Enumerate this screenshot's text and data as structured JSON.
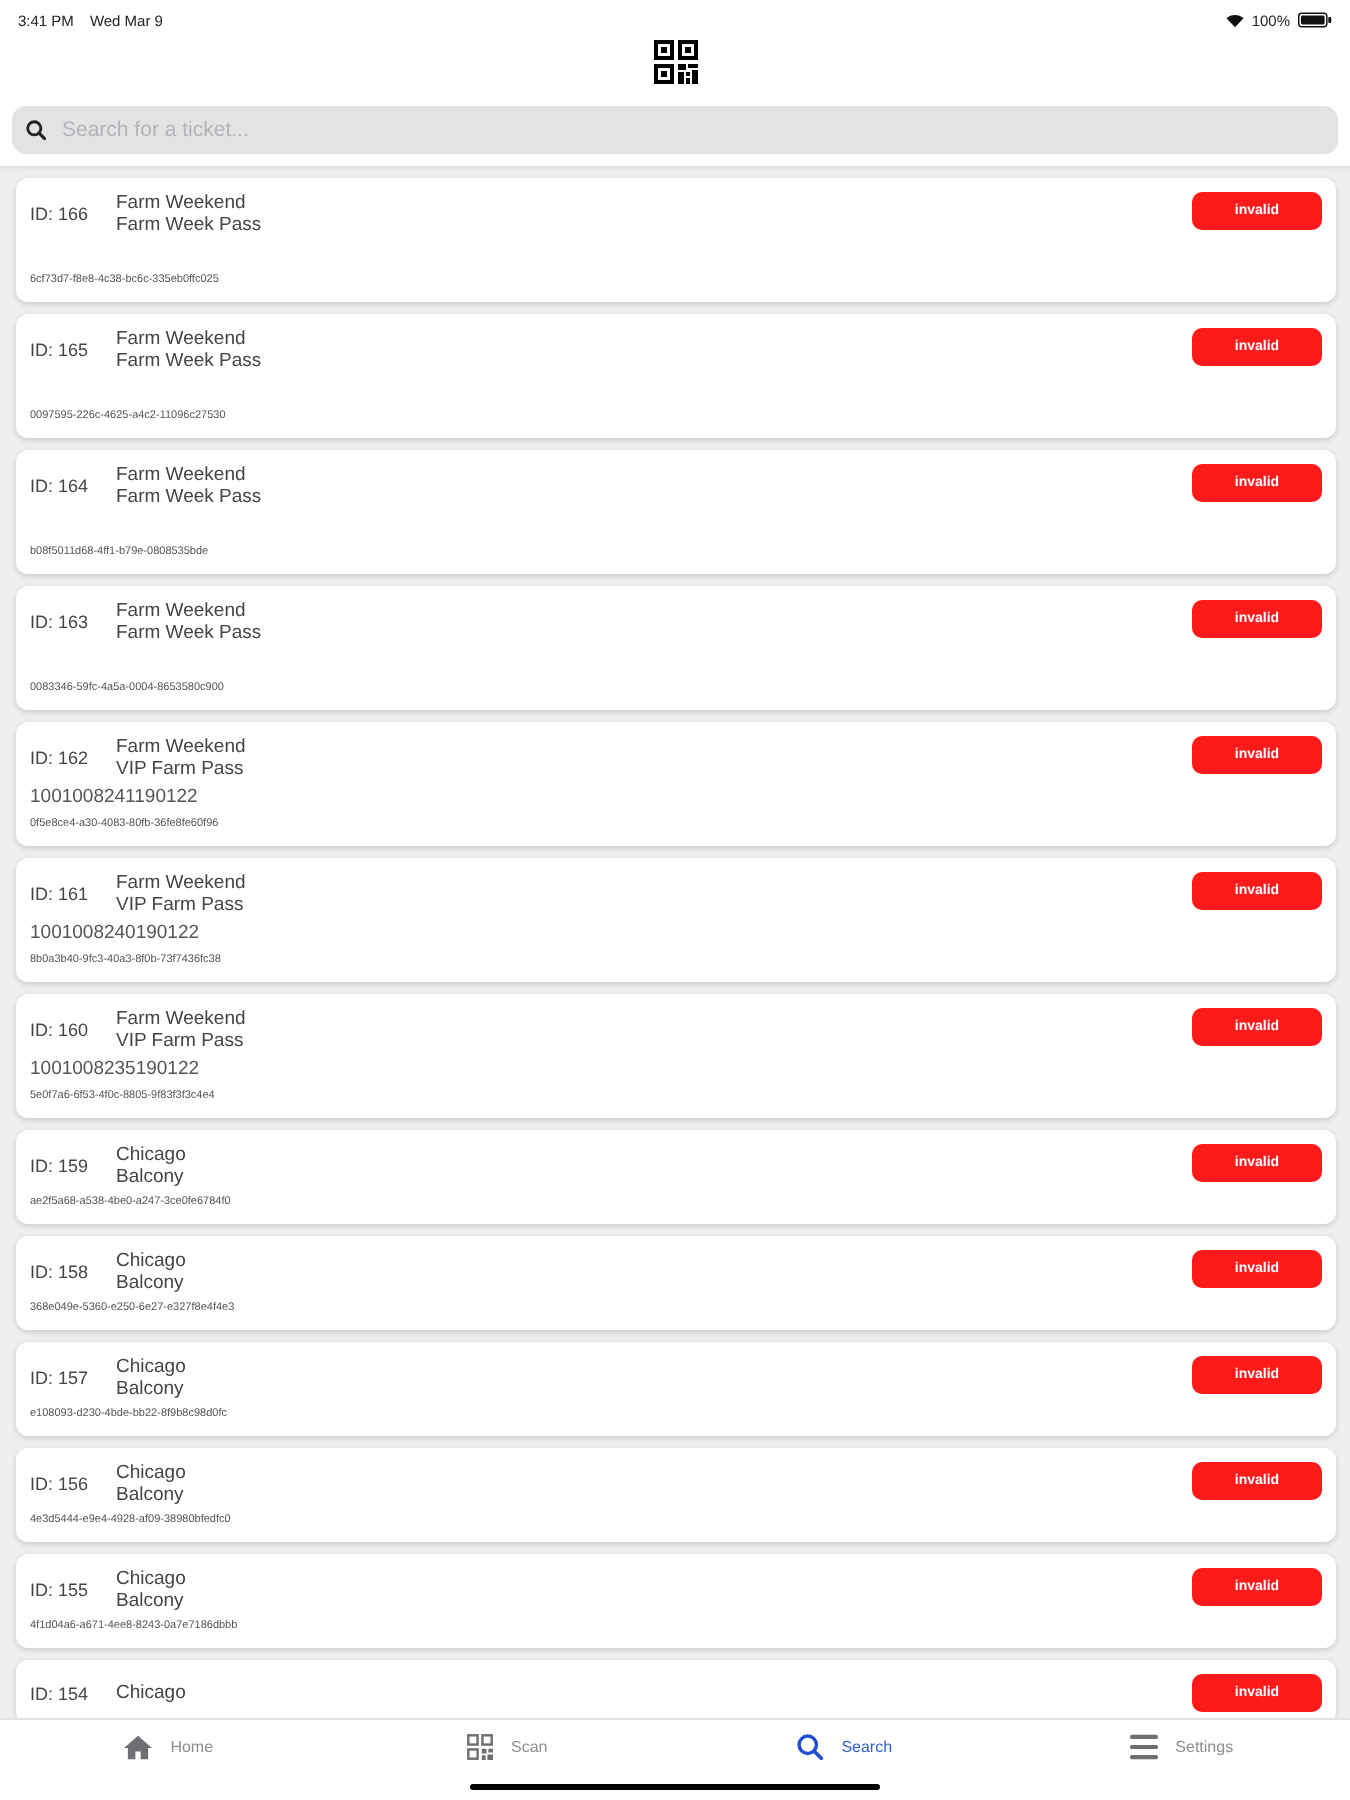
{
  "status_bar": {
    "time": "3:41 PM",
    "date": "Wed Mar 9",
    "battery": "100%"
  },
  "search": {
    "placeholder": "Search for a ticket..."
  },
  "tickets": [
    {
      "kind": "full",
      "id": "ID: 166",
      "event": "Farm Weekend",
      "ticket_type": "Farm Week Pass",
      "uuid": "6cf73d7-f8e8-4c38-bc6c-335eb0ffc025",
      "status": "invalid"
    },
    {
      "kind": "full",
      "id": "ID: 165",
      "event": "Farm Weekend",
      "ticket_type": "Farm Week Pass",
      "uuid": "0097595-226c-4625-a4c2-11096c27530",
      "status": "invalid"
    },
    {
      "kind": "full",
      "id": "ID: 164",
      "event": "Farm Weekend",
      "ticket_type": "Farm Week Pass",
      "uuid": "b08f5011d68-4ff1-b79e-0808535bde",
      "status": "invalid"
    },
    {
      "kind": "full",
      "id": "ID: 163",
      "event": "Farm Weekend",
      "ticket_type": "Farm Week Pass",
      "uuid": "0083346-59fc-4a5a-0004-8653580c900",
      "status": "invalid"
    },
    {
      "kind": "full",
      "id": "ID: 162",
      "event": "Farm Weekend",
      "ticket_type": "VIP Farm Pass",
      "barcode": "1001008241190122",
      "uuid": "0f5e8ce4-a30-4083-80fb-36fe8fe60f96",
      "status": "invalid"
    },
    {
      "kind": "full",
      "id": "ID: 161",
      "event": "Farm Weekend",
      "ticket_type": "VIP Farm Pass",
      "barcode": "1001008240190122",
      "uuid": "8b0a3b40-9fc3-40a3-8f0b-73f7436fc38",
      "status": "invalid"
    },
    {
      "kind": "full",
      "id": "ID: 160",
      "event": "Farm Weekend",
      "ticket_type": "VIP Farm Pass",
      "barcode": "1001008235190122",
      "uuid": "5e0f7a6-6f53-4f0c-8805-9f83f3f3c4e4",
      "status": "invalid"
    },
    {
      "kind": "compact",
      "id": "ID: 159",
      "event": "Chicago",
      "ticket_type": "Balcony",
      "uuid": "ae2f5a68-a538-4be0-a247-3ce0fe6784f0",
      "status": "invalid"
    },
    {
      "kind": "compact",
      "id": "ID: 158",
      "event": "Chicago",
      "ticket_type": "Balcony",
      "uuid": "368e049e-5360-e250-6e27-e327f8e4f4e3",
      "status": "invalid"
    },
    {
      "kind": "compact",
      "id": "ID: 157",
      "event": "Chicago",
      "ticket_type": "Balcony",
      "uuid": "e108093-d230-4bde-bb22-8f9b8c98d0fc",
      "status": "invalid"
    },
    {
      "kind": "compact",
      "id": "ID: 156",
      "event": "Chicago",
      "ticket_type": "Balcony",
      "uuid": "4e3d5444-e9e4-4928-af09-38980bfedfc0",
      "status": "invalid"
    },
    {
      "kind": "compact",
      "id": "ID: 155",
      "event": "Chicago",
      "ticket_type": "Balcony",
      "uuid": "4f1d04a6-a671-4ee8-8243-0a7e7186dbbb",
      "status": "invalid"
    },
    {
      "kind": "compact",
      "id": "ID: 154",
      "event": "Chicago",
      "status": "invalid"
    }
  ],
  "tab_bar": [
    {
      "kind": "home",
      "label": "Home",
      "selected": false
    },
    {
      "kind": "scan",
      "label": "Scan",
      "selected": false
    },
    {
      "kind": "search",
      "label": "Search",
      "selected": true
    },
    {
      "kind": "settings",
      "label": "Settings",
      "selected": false
    }
  ]
}
